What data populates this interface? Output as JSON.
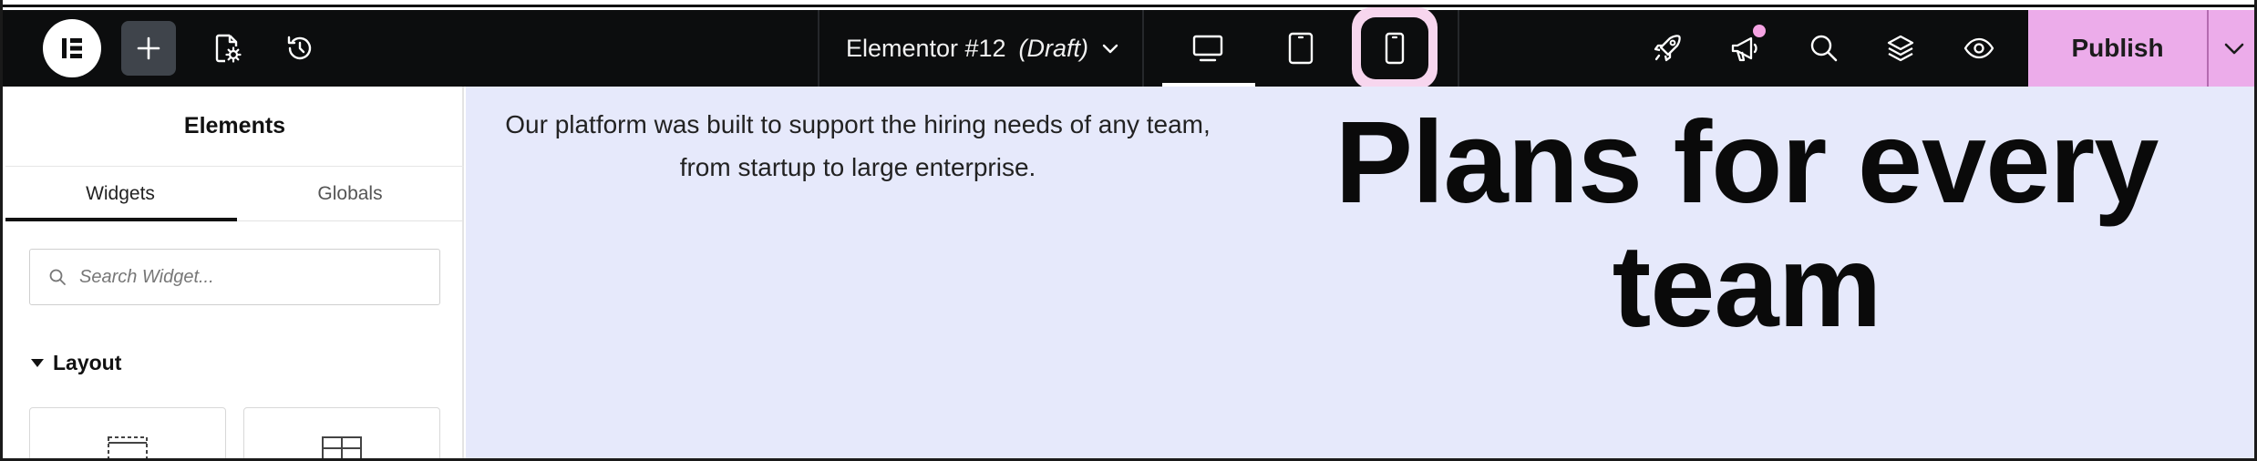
{
  "topbar": {
    "document_title": "Elementor #12",
    "document_status": "(Draft)",
    "publish_label": "Publish",
    "icons": {
      "logo": "elementor-logo-icon",
      "add": "plus-icon",
      "page_settings": "page-settings-icon",
      "history": "history-icon",
      "desktop": "desktop-icon",
      "tablet": "tablet-icon",
      "mobile": "mobile-icon",
      "launch": "rocket-icon",
      "whats_new": "megaphone-icon",
      "finder": "search-icon",
      "structure": "layers-icon",
      "preview": "eye-icon"
    },
    "active_device": "desktop",
    "highlighted_device": "mobile"
  },
  "panel": {
    "title": "Elements",
    "tabs": [
      "Widgets",
      "Globals"
    ],
    "active_tab": "Widgets",
    "search_placeholder": "Search Widget...",
    "category": "Layout"
  },
  "canvas": {
    "intro_text": "Our platform was built to support the hiring needs of any team, from startup to large enterprise.",
    "hero_heading": "Plans for every team"
  },
  "colors": {
    "topbar_bg": "#0c0d0e",
    "publish_bg": "#ecacea",
    "highlight": "#f7d6ee",
    "notification_dot": "#f5a3e3",
    "canvas_bg": "#e6e9fb"
  }
}
